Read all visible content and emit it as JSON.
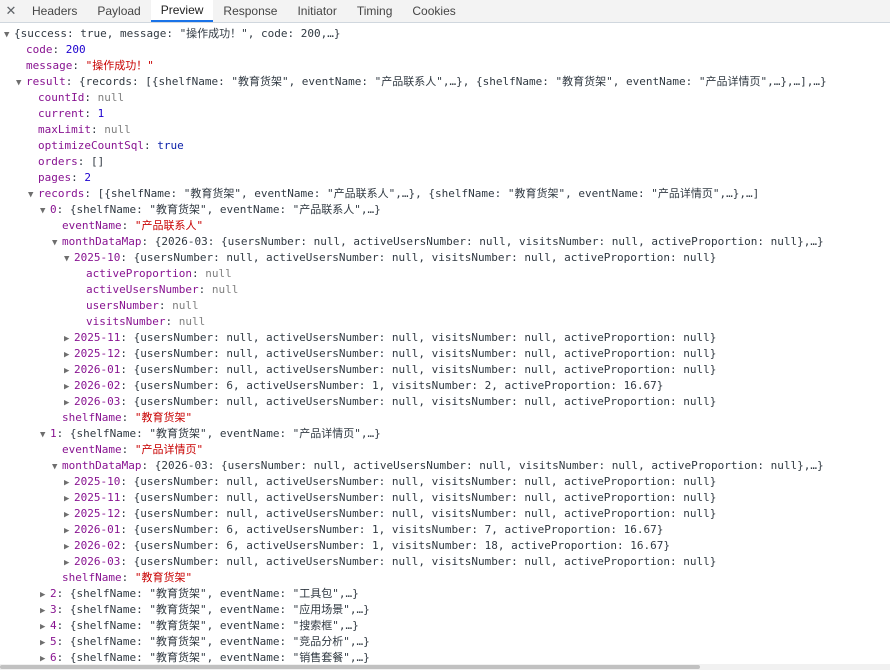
{
  "tabs": {
    "close_icon": "✕",
    "items": [
      "Headers",
      "Payload",
      "Preview",
      "Response",
      "Initiator",
      "Timing",
      "Cookies"
    ],
    "active": "Preview"
  },
  "rows": [
    {
      "indent": 0,
      "tri": "down",
      "key": "",
      "preview": "{success: true, message: \"操作成功！\", code: 200,…}"
    },
    {
      "indent": 1,
      "tri": "none",
      "key": "code",
      "value": "200",
      "vtype": "num"
    },
    {
      "indent": 1,
      "tri": "none",
      "key": "message",
      "value": "\"操作成功！\"",
      "vtype": "str"
    },
    {
      "indent": 1,
      "tri": "down",
      "key": "result",
      "preview": "{records: [{shelfName: \"教育货架\", eventName: \"产品联系人\",…}, {shelfName: \"教育货架\", eventName: \"产品详情页\",…},…],…}"
    },
    {
      "indent": 2,
      "tri": "none",
      "key": "countId",
      "value": "null",
      "vtype": "nul"
    },
    {
      "indent": 2,
      "tri": "none",
      "key": "current",
      "value": "1",
      "vtype": "num"
    },
    {
      "indent": 2,
      "tri": "none",
      "key": "maxLimit",
      "value": "null",
      "vtype": "nul"
    },
    {
      "indent": 2,
      "tri": "none",
      "key": "optimizeCountSql",
      "value": "true",
      "vtype": "bool"
    },
    {
      "indent": 2,
      "tri": "none",
      "key": "orders",
      "value": "[]",
      "vtype": "preview"
    },
    {
      "indent": 2,
      "tri": "none",
      "key": "pages",
      "value": "2",
      "vtype": "num"
    },
    {
      "indent": 2,
      "tri": "down",
      "key": "records",
      "preview": "[{shelfName: \"教育货架\", eventName: \"产品联系人\",…}, {shelfName: \"教育货架\", eventName: \"产品详情页\",…},…]"
    },
    {
      "indent": 3,
      "tri": "down",
      "key": "0",
      "preview": "{shelfName: \"教育货架\", eventName: \"产品联系人\",…}"
    },
    {
      "indent": 4,
      "tri": "none",
      "key": "eventName",
      "value": "\"产品联系人\"",
      "vtype": "str"
    },
    {
      "indent": 4,
      "tri": "down",
      "key": "monthDataMap",
      "preview": "{2026-03: {usersNumber: null, activeUsersNumber: null, visitsNumber: null, activeProportion: null},…}"
    },
    {
      "indent": 5,
      "tri": "down",
      "key": "2025-10",
      "preview": "{usersNumber: null, activeUsersNumber: null, visitsNumber: null, activeProportion: null}"
    },
    {
      "indent": 6,
      "tri": "none",
      "key": "activeProportion",
      "value": "null",
      "vtype": "nul"
    },
    {
      "indent": 6,
      "tri": "none",
      "key": "activeUsersNumber",
      "value": "null",
      "vtype": "nul"
    },
    {
      "indent": 6,
      "tri": "none",
      "key": "usersNumber",
      "value": "null",
      "vtype": "nul"
    },
    {
      "indent": 6,
      "tri": "none",
      "key": "visitsNumber",
      "value": "null",
      "vtype": "nul"
    },
    {
      "indent": 5,
      "tri": "right",
      "key": "2025-11",
      "preview": "{usersNumber: null, activeUsersNumber: null, visitsNumber: null, activeProportion: null}"
    },
    {
      "indent": 5,
      "tri": "right",
      "key": "2025-12",
      "preview": "{usersNumber: null, activeUsersNumber: null, visitsNumber: null, activeProportion: null}"
    },
    {
      "indent": 5,
      "tri": "right",
      "key": "2026-01",
      "preview": "{usersNumber: null, activeUsersNumber: null, visitsNumber: null, activeProportion: null}"
    },
    {
      "indent": 5,
      "tri": "right",
      "key": "2026-02",
      "preview": "{usersNumber: 6, activeUsersNumber: 1, visitsNumber: 2, activeProportion: 16.67}"
    },
    {
      "indent": 5,
      "tri": "right",
      "key": "2026-03",
      "preview": "{usersNumber: null, activeUsersNumber: null, visitsNumber: null, activeProportion: null}"
    },
    {
      "indent": 4,
      "tri": "none",
      "key": "shelfName",
      "value": "\"教育货架\"",
      "vtype": "str"
    },
    {
      "indent": 3,
      "tri": "down",
      "key": "1",
      "preview": "{shelfName: \"教育货架\", eventName: \"产品详情页\",…}"
    },
    {
      "indent": 4,
      "tri": "none",
      "key": "eventName",
      "value": "\"产品详情页\"",
      "vtype": "str"
    },
    {
      "indent": 4,
      "tri": "down",
      "key": "monthDataMap",
      "preview": "{2026-03: {usersNumber: null, activeUsersNumber: null, visitsNumber: null, activeProportion: null},…}"
    },
    {
      "indent": 5,
      "tri": "right",
      "key": "2025-10",
      "preview": "{usersNumber: null, activeUsersNumber: null, visitsNumber: null, activeProportion: null}"
    },
    {
      "indent": 5,
      "tri": "right",
      "key": "2025-11",
      "preview": "{usersNumber: null, activeUsersNumber: null, visitsNumber: null, activeProportion: null}"
    },
    {
      "indent": 5,
      "tri": "right",
      "key": "2025-12",
      "preview": "{usersNumber: null, activeUsersNumber: null, visitsNumber: null, activeProportion: null}"
    },
    {
      "indent": 5,
      "tri": "right",
      "key": "2026-01",
      "preview": "{usersNumber: 6, activeUsersNumber: 1, visitsNumber: 7, activeProportion: 16.67}"
    },
    {
      "indent": 5,
      "tri": "right",
      "key": "2026-02",
      "preview": "{usersNumber: 6, activeUsersNumber: 1, visitsNumber: 18, activeProportion: 16.67}"
    },
    {
      "indent": 5,
      "tri": "right",
      "key": "2026-03",
      "preview": "{usersNumber: null, activeUsersNumber: null, visitsNumber: null, activeProportion: null}"
    },
    {
      "indent": 4,
      "tri": "none",
      "key": "shelfName",
      "value": "\"教育货架\"",
      "vtype": "str"
    },
    {
      "indent": 3,
      "tri": "right",
      "key": "2",
      "preview": "{shelfName: \"教育货架\", eventName: \"工具包\",…}"
    },
    {
      "indent": 3,
      "tri": "right",
      "key": "3",
      "preview": "{shelfName: \"教育货架\", eventName: \"应用场景\",…}"
    },
    {
      "indent": 3,
      "tri": "right",
      "key": "4",
      "preview": "{shelfName: \"教育货架\", eventName: \"搜索框\",…}"
    },
    {
      "indent": 3,
      "tri": "right",
      "key": "5",
      "preview": "{shelfName: \"教育货架\", eventName: \"竞品分析\",…}"
    },
    {
      "indent": 3,
      "tri": "right",
      "key": "6",
      "preview": "{shelfName: \"教育货架\", eventName: \"销售套餐\",…}"
    }
  ]
}
